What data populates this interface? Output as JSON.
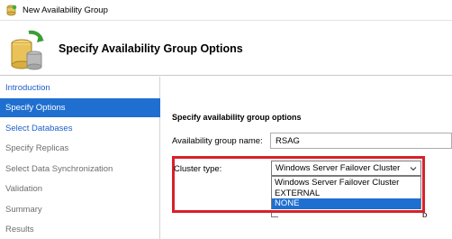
{
  "window": {
    "title": "New Availability Group"
  },
  "header": {
    "title": "Specify Availability Group Options"
  },
  "sidebar": {
    "items": [
      {
        "label": "Introduction",
        "state": "link"
      },
      {
        "label": "Specify Options",
        "state": "selected"
      },
      {
        "label": "Select Databases",
        "state": "link"
      },
      {
        "label": "Specify Replicas",
        "state": "disabled"
      },
      {
        "label": "Select Data Synchronization",
        "state": "disabled"
      },
      {
        "label": "Validation",
        "state": "disabled"
      },
      {
        "label": "Summary",
        "state": "disabled"
      },
      {
        "label": "Results",
        "state": "disabled"
      }
    ]
  },
  "main": {
    "section_title": "Specify availability group options",
    "ag_name_label": "Availability group name:",
    "ag_name_value": "RSAG",
    "cluster_type_label": "Cluster type:",
    "cluster_type_value": "Windows Server Failover Cluster",
    "cluster_type_options": [
      "Windows Server Failover Cluster",
      "EXTERNAL",
      "NONE"
    ],
    "highlighted_option": "NONE",
    "partial_text_tail": "p"
  },
  "colors": {
    "accent": "#1f6fd0",
    "link": "#1c5fc9",
    "highlight_border": "#d9202a"
  },
  "icons": {
    "title": "availability-group-icon",
    "header": "database-sync-icon",
    "dropdown": "chevron-down-icon"
  }
}
